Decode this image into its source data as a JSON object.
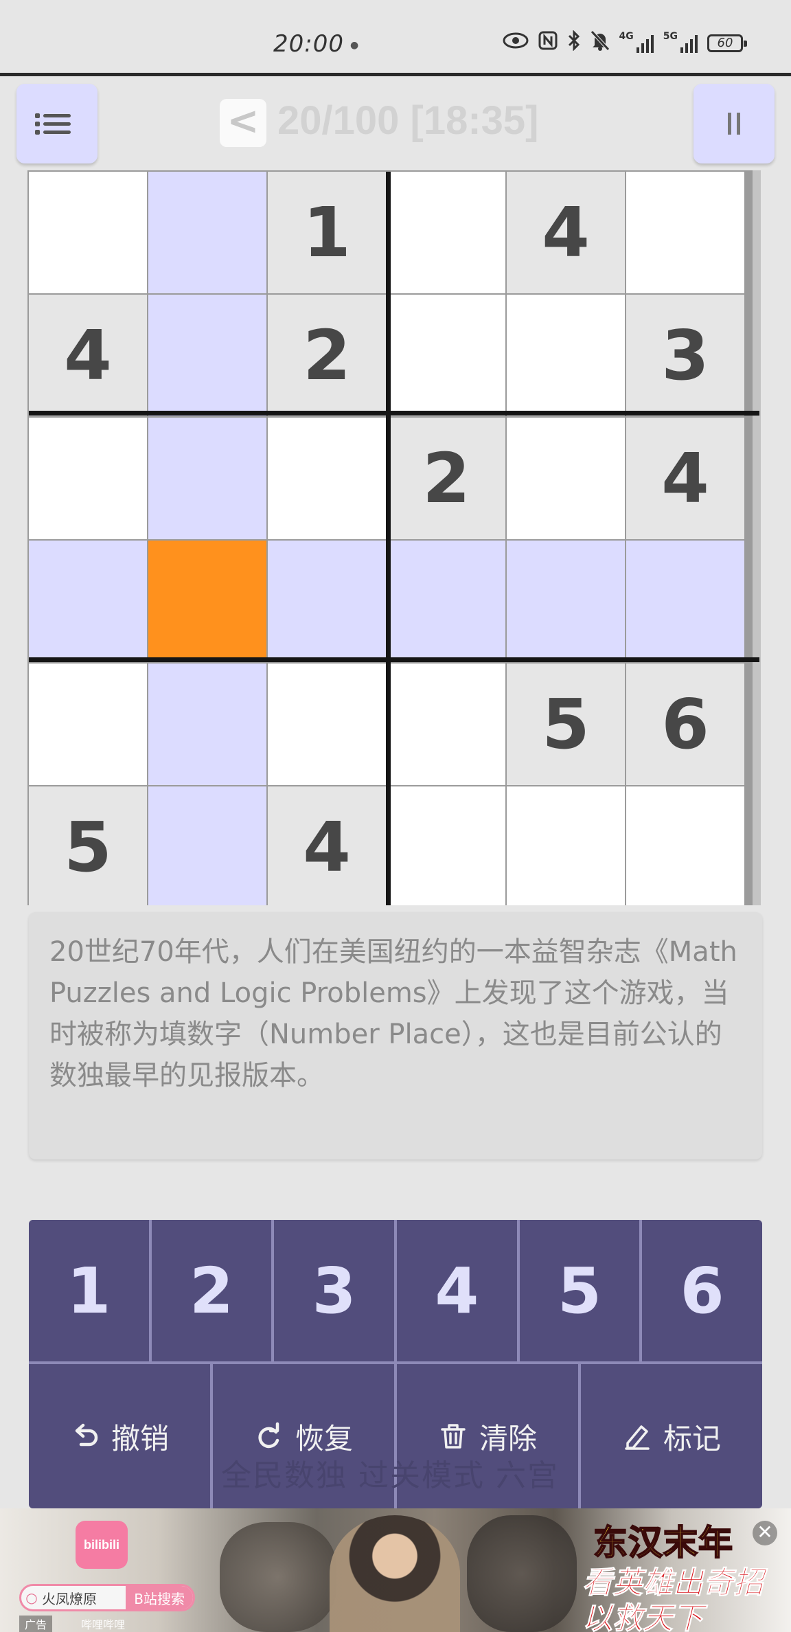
{
  "status_bar": {
    "time": "20:00",
    "signal_1": "4G",
    "signal_2": "5G",
    "battery": "60",
    "icons": [
      "eye-icon",
      "nfc-icon",
      "bluetooth-icon",
      "bell-off-icon",
      "signal-icon",
      "battery-icon"
    ]
  },
  "header": {
    "back_label": "<",
    "level_title": "20/100 [18:35]"
  },
  "grid": {
    "rows": [
      [
        "",
        "",
        "1",
        "",
        "4",
        ""
      ],
      [
        "4",
        "",
        "2",
        "",
        "",
        "3"
      ],
      [
        "",
        "",
        "",
        "2",
        "",
        "4"
      ],
      [
        "",
        "",
        "",
        "",
        "",
        ""
      ],
      [
        "",
        "",
        "",
        "",
        "5",
        "6"
      ],
      [
        "5",
        "",
        "4",
        "",
        "",
        ""
      ]
    ],
    "selected_cell": [
      3,
      1
    ],
    "colors": {
      "empty": "#ffffff",
      "given": "#e6e6e6",
      "highlight": "#dcdcff",
      "selected": "#ff911d"
    }
  },
  "info_text": "20世纪70年代，人们在美国纽约的一本益智杂志《Math Puzzles and Logic Problems》上发现了这个游戏，当时被称为填数字（Number Place），这也是目前公认的数独最早的见报版本。",
  "keypad": {
    "numbers": [
      "1",
      "2",
      "3",
      "4",
      "5",
      "6"
    ],
    "actions": [
      {
        "name": "undo",
        "label": "撤销",
        "icon": "undo-icon"
      },
      {
        "name": "redo",
        "label": "恢复",
        "icon": "redo-icon"
      },
      {
        "name": "clear",
        "label": "清除",
        "icon": "trash-icon"
      },
      {
        "name": "mark",
        "label": "标记",
        "icon": "pencil-icon"
      }
    ],
    "watermark": "全民数独 过关模式 六宫"
  },
  "ad": {
    "logo": "bilibili",
    "search_text": "火凤燎原",
    "search_button": "B站搜索",
    "label": "广告",
    "sub": "哔哩哔哩",
    "title": "东汉末年",
    "slogan_1": "看英雄出奇招",
    "slogan_2": "以救天下",
    "close": "✕"
  }
}
